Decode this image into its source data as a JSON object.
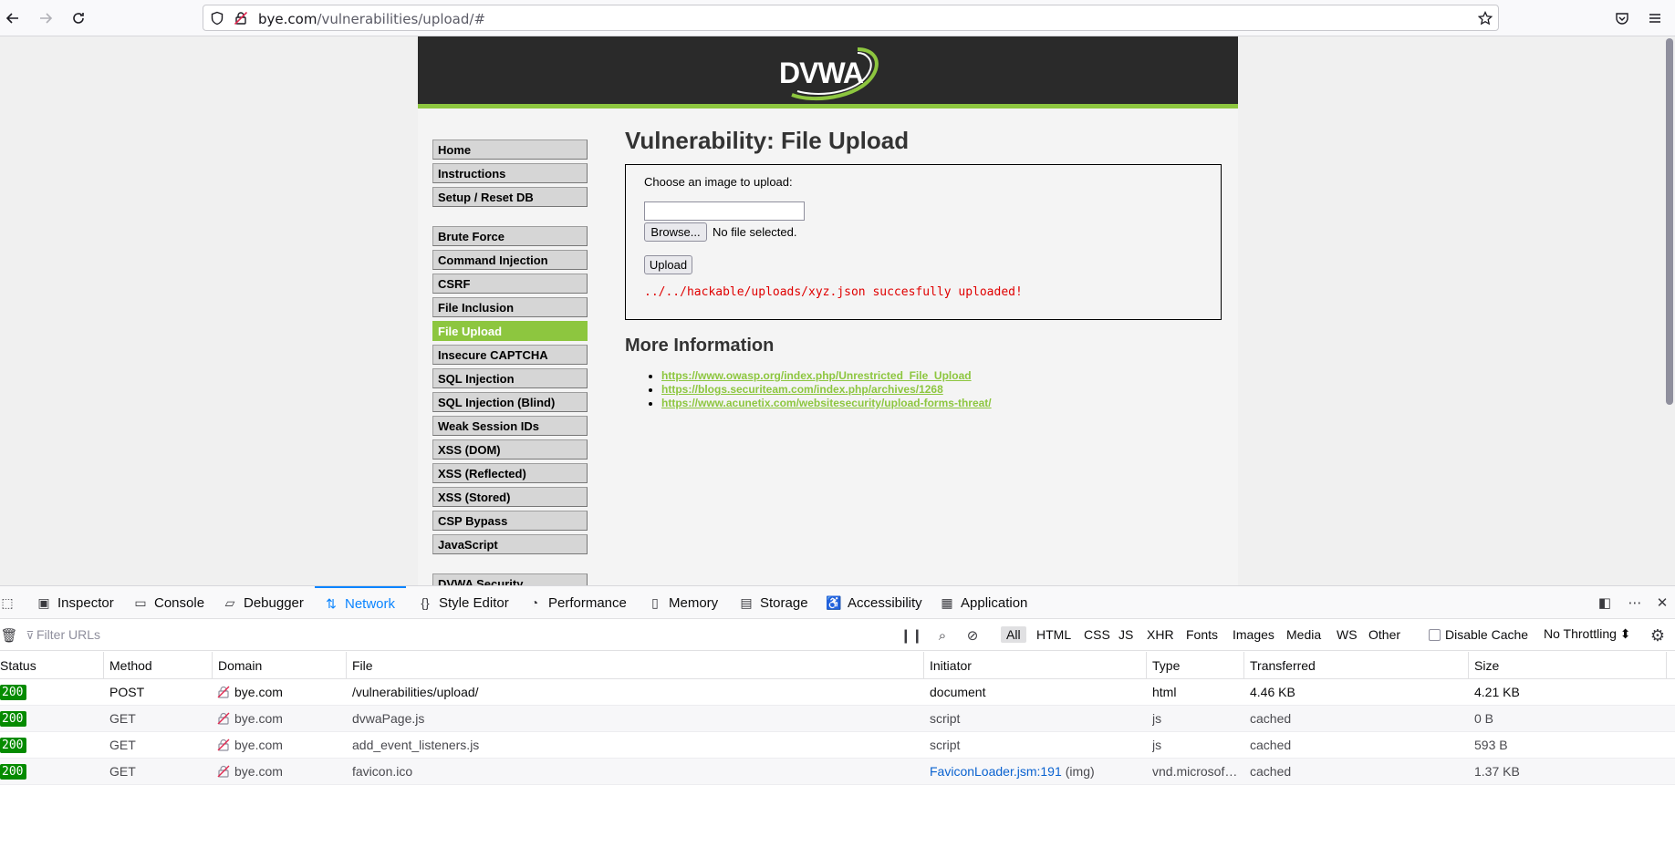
{
  "browser": {
    "url_host": "bye.com",
    "url_path": "/vulnerabilities/upload/#"
  },
  "dvwa": {
    "logo": "DVWA",
    "menu_group1": [
      "Home",
      "Instructions",
      "Setup / Reset DB"
    ],
    "menu_group2": [
      "Brute Force",
      "Command Injection",
      "CSRF",
      "File Inclusion",
      "File Upload",
      "Insecure CAPTCHA",
      "SQL Injection",
      "SQL Injection (Blind)",
      "Weak Session IDs",
      "XSS (DOM)",
      "XSS (Reflected)",
      "XSS (Stored)",
      "CSP Bypass",
      "JavaScript"
    ],
    "menu_group3": [
      "DVWA Security"
    ],
    "active_item": "File Upload",
    "title": "Vulnerability: File Upload",
    "choose_label": "Choose an image to upload:",
    "browse_label": "Browse...",
    "no_file": "No file selected.",
    "upload_label": "Upload",
    "result_message": "../../hackable/uploads/xyz.json succesfully uploaded!",
    "more_info_title": "More Information",
    "links": [
      "https://www.owasp.org/index.php/Unrestricted_File_Upload",
      "https://blogs.securiteam.com/index.php/archives/1268",
      "https://www.acunetix.com/websitesecurity/upload-forms-threat/"
    ],
    "accent_color": "#8dc63f"
  },
  "devtools": {
    "tabs": [
      "Inspector",
      "Console",
      "Debugger",
      "Network",
      "Style Editor",
      "Performance",
      "Memory",
      "Storage",
      "Accessibility",
      "Application"
    ],
    "active_tab": "Network",
    "filter_placeholder": "Filter URLs",
    "type_filters": [
      "All",
      "HTML",
      "CSS",
      "JS",
      "XHR",
      "Fonts",
      "Images",
      "Media",
      "WS",
      "Other"
    ],
    "disable_cache": "Disable Cache",
    "throttling": "No Throttling ⬍",
    "columns": [
      "Status",
      "Method",
      "Domain",
      "File",
      "Initiator",
      "Type",
      "Transferred",
      "Size"
    ],
    "requests": [
      {
        "status": "200",
        "method": "POST",
        "domain": "bye.com",
        "file": "/vulnerabilities/upload/",
        "initiator": "document",
        "initiator_extra": "",
        "type": "html",
        "transferred": "4.46 KB",
        "size": "4.21 KB"
      },
      {
        "status": "200",
        "method": "GET",
        "domain": "bye.com",
        "file": "dvwaPage.js",
        "initiator": "script",
        "initiator_extra": "",
        "type": "js",
        "transferred": "cached",
        "size": "0 B"
      },
      {
        "status": "200",
        "method": "GET",
        "domain": "bye.com",
        "file": "add_event_listeners.js",
        "initiator": "script",
        "initiator_extra": "",
        "type": "js",
        "transferred": "cached",
        "size": "593 B"
      },
      {
        "status": "200",
        "method": "GET",
        "domain": "bye.com",
        "file": "favicon.ico",
        "initiator": "FaviconLoader.jsm:191",
        "initiator_extra": "(img)",
        "type": "vnd.microsof…",
        "transferred": "cached",
        "size": "1.37 KB"
      }
    ]
  }
}
